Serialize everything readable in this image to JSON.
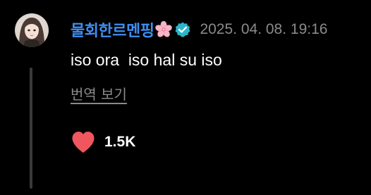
{
  "comment": {
    "author": {
      "name": "물회한르멘핑",
      "emoji_icon": "cherry-blossom-icon",
      "verified_icon": "verified-badge-icon",
      "verified_color": "#2bb5c9"
    },
    "timestamp": "2025. 04. 08. 19:16",
    "text": "iso ora  iso hal su iso",
    "translate_label": "번역 보기",
    "likes": {
      "icon": "heart-icon",
      "count": "1.5K",
      "liked": true,
      "color": "#f0565e"
    }
  },
  "colors": {
    "background": "#000000",
    "username": "#3e8ef0",
    "muted": "#8a8a8a",
    "thread_line": "#3a3a3a"
  }
}
